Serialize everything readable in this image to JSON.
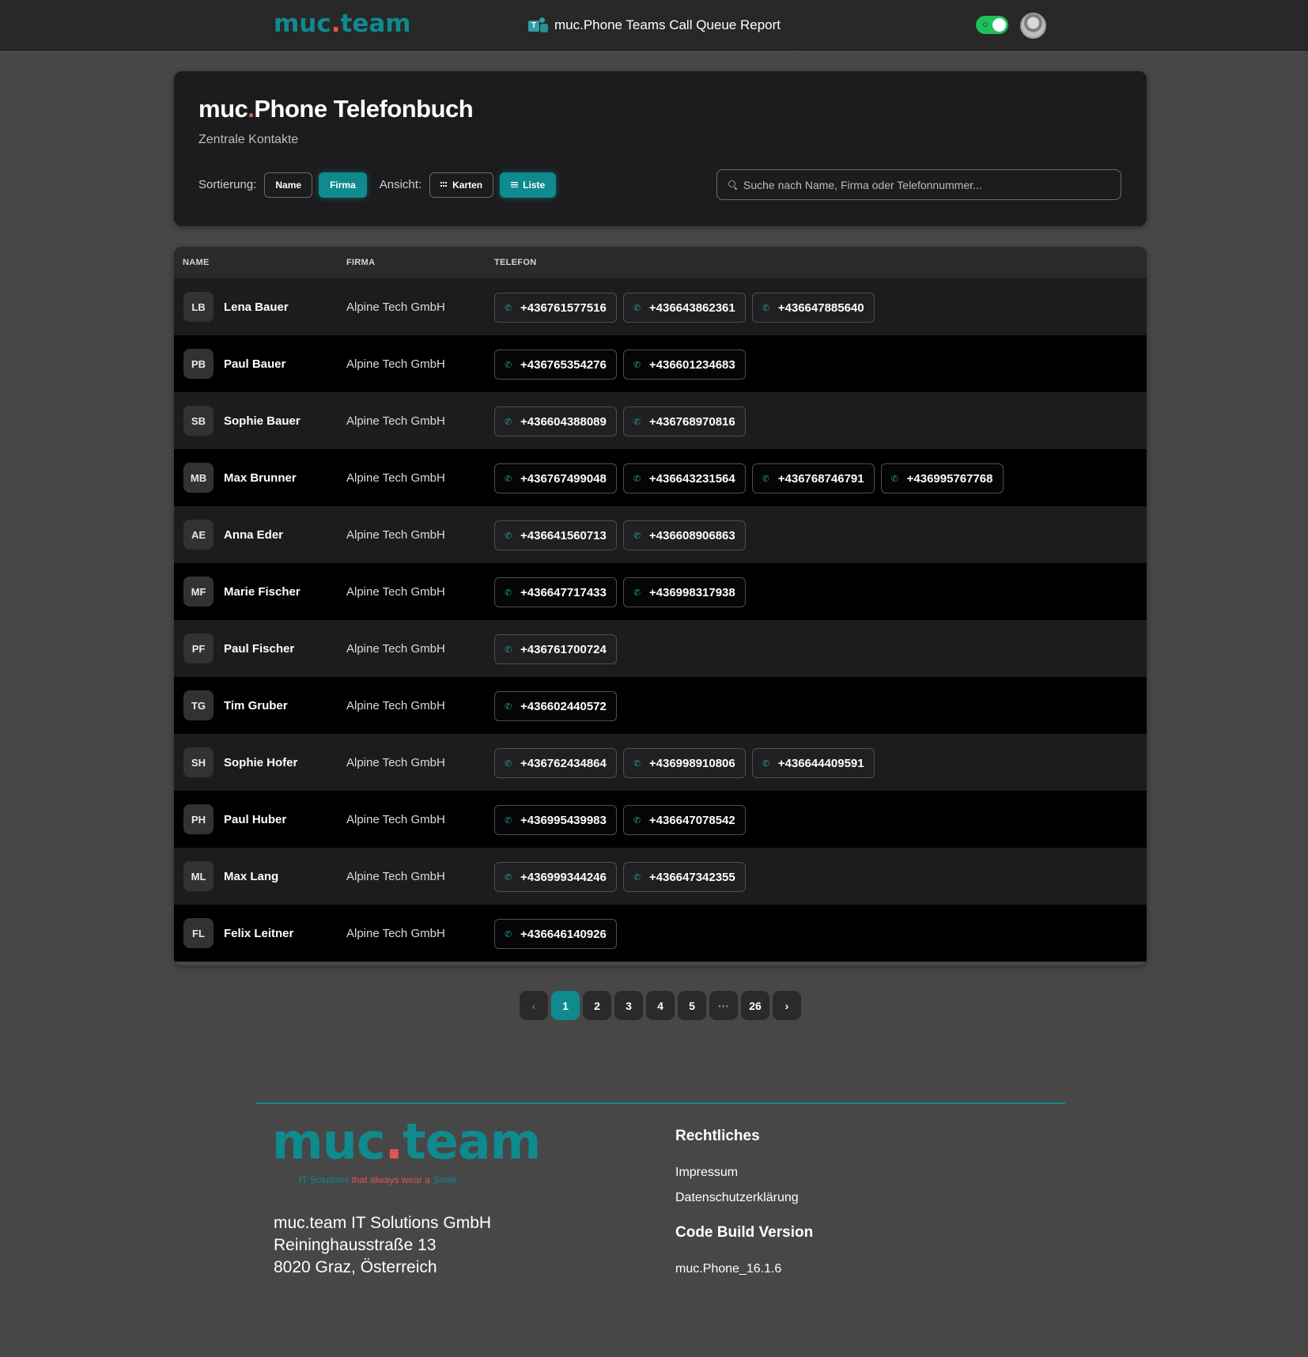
{
  "topbar": {
    "brand_pre": "muc",
    "brand_dot": ".",
    "brand_post": "team",
    "report_title": "muc.Phone Teams Call Queue Report",
    "teams_icon_letter": "T"
  },
  "header": {
    "title_pre": "muc",
    "title_dot": ".",
    "title_post": "Phone Telefonbuch",
    "subtitle": "Zentrale Kontakte",
    "sort_label": "Sortierung:",
    "sort_options": [
      "Name",
      "Firma"
    ],
    "sort_active": "Firma",
    "view_label": "Ansicht:",
    "view_cards": "Karten",
    "view_list": "Liste",
    "view_active": "Liste",
    "search_placeholder": "Suche nach Name, Firma oder Telefonnummer..."
  },
  "table": {
    "columns": [
      "NAME",
      "FIRMA",
      "TELEFON"
    ],
    "rows": [
      {
        "initials": "LB",
        "name": "Lena Bauer",
        "company": "Alpine Tech GmbH",
        "phones": [
          "+436761577516",
          "+436643862361",
          "+436647885640"
        ]
      },
      {
        "initials": "PB",
        "name": "Paul Bauer",
        "company": "Alpine Tech GmbH",
        "phones": [
          "+436765354276",
          "+436601234683"
        ]
      },
      {
        "initials": "SB",
        "name": "Sophie Bauer",
        "company": "Alpine Tech GmbH",
        "phones": [
          "+436604388089",
          "+436768970816"
        ]
      },
      {
        "initials": "MB",
        "name": "Max Brunner",
        "company": "Alpine Tech GmbH",
        "phones": [
          "+436767499048",
          "+436643231564",
          "+436768746791",
          "+436995767768"
        ]
      },
      {
        "initials": "AE",
        "name": "Anna Eder",
        "company": "Alpine Tech GmbH",
        "phones": [
          "+436641560713",
          "+436608906863"
        ]
      },
      {
        "initials": "MF",
        "name": "Marie Fischer",
        "company": "Alpine Tech GmbH",
        "phones": [
          "+436647717433",
          "+436998317938"
        ]
      },
      {
        "initials": "PF",
        "name": "Paul Fischer",
        "company": "Alpine Tech GmbH",
        "phones": [
          "+436761700724"
        ]
      },
      {
        "initials": "TG",
        "name": "Tim Gruber",
        "company": "Alpine Tech GmbH",
        "phones": [
          "+436602440572"
        ]
      },
      {
        "initials": "SH",
        "name": "Sophie Hofer",
        "company": "Alpine Tech GmbH",
        "phones": [
          "+436762434864",
          "+436998910806",
          "+436644409591"
        ]
      },
      {
        "initials": "PH",
        "name": "Paul Huber",
        "company": "Alpine Tech GmbH",
        "phones": [
          "+436995439983",
          "+436647078542"
        ]
      },
      {
        "initials": "ML",
        "name": "Max Lang",
        "company": "Alpine Tech GmbH",
        "phones": [
          "+436999344246",
          "+436647342355"
        ]
      },
      {
        "initials": "FL",
        "name": "Felix Leitner",
        "company": "Alpine Tech GmbH",
        "phones": [
          "+436646140926"
        ]
      }
    ]
  },
  "pagination": {
    "prev": "‹",
    "pages": [
      "1",
      "2",
      "3",
      "4",
      "5",
      "···",
      "26"
    ],
    "current": "1",
    "next": "›"
  },
  "footer": {
    "logo_pre": "muc",
    "logo_dot": ".",
    "logo_post": "team",
    "tagline_start": "IT Solutions",
    "tagline_mid": "that always wear a",
    "tagline_end": "Smile",
    "address_lines": [
      "muc.team IT Solutions GmbH",
      "Reininghausstraße 13",
      "8020 Graz, Österreich"
    ],
    "legal_heading": "Rechtliches",
    "legal_links": [
      "Impressum",
      "Datenschutzerklärung"
    ],
    "build_heading": "Code Build Version",
    "build_version": "muc.Phone_16.1.6"
  },
  "colors": {
    "accent": "#0f8a8e",
    "dot": "#e0564f",
    "toggle_on": "#1fbf5c"
  }
}
